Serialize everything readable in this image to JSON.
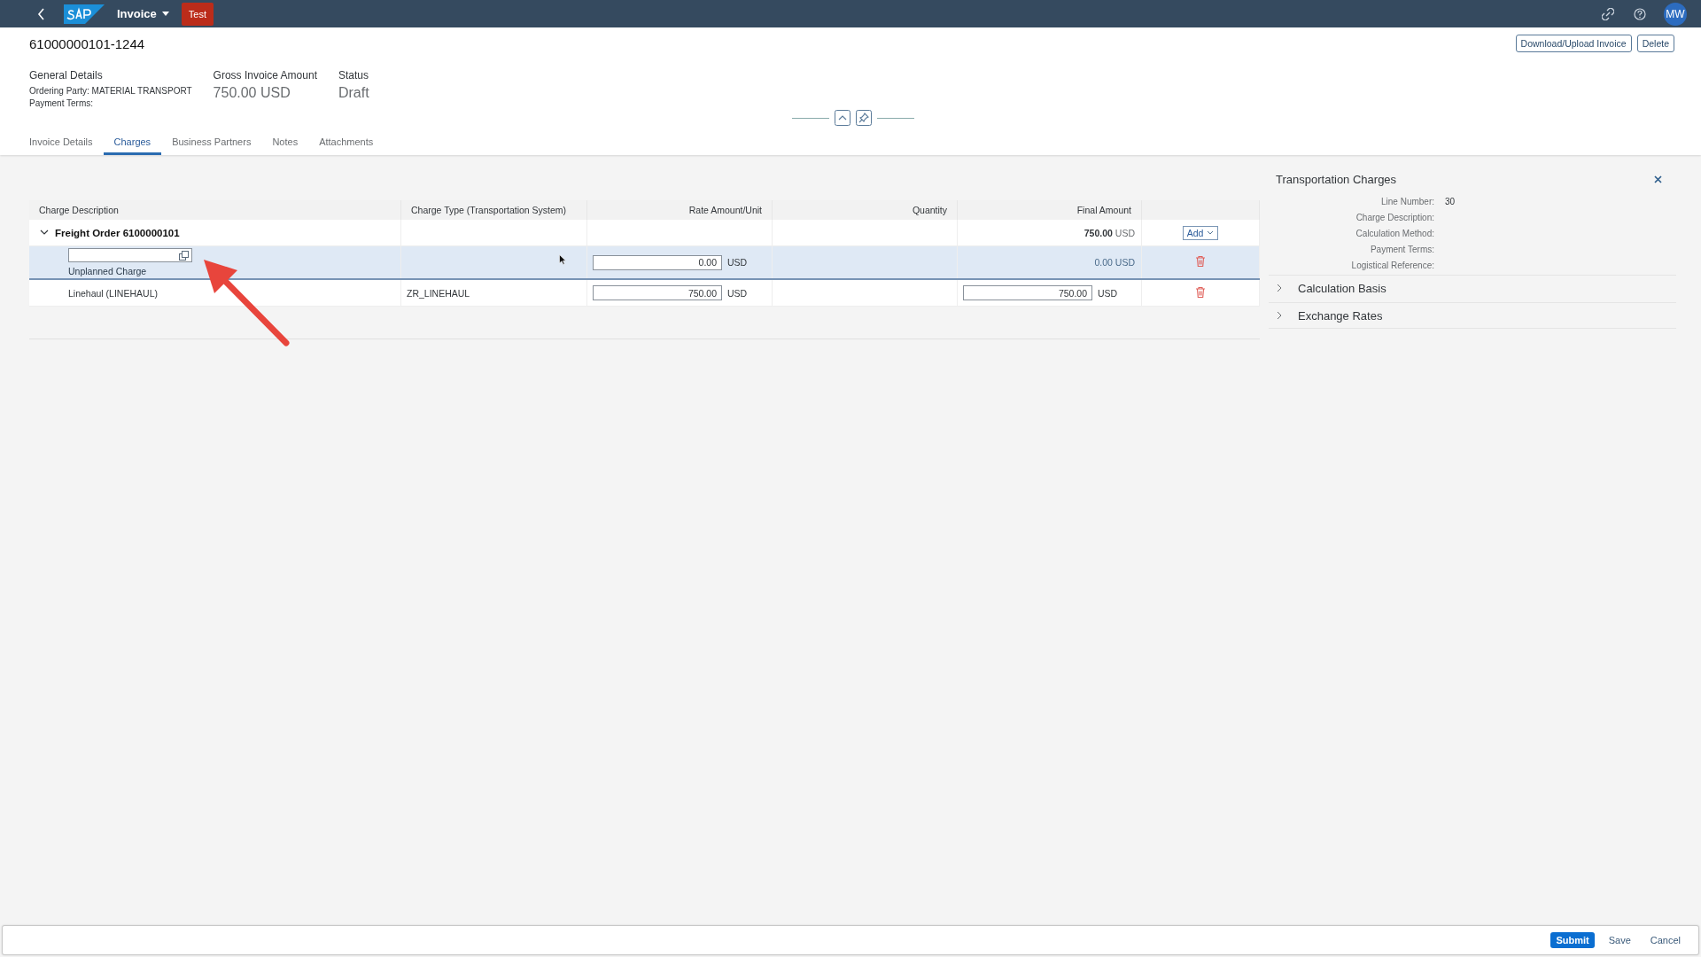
{
  "shell": {
    "title": "Invoice",
    "system_badge": "Test",
    "avatar": "MW"
  },
  "header": {
    "object_id": "61000000101-1244",
    "actions": [
      "Download/Upload Invoice",
      "Delete"
    ],
    "general": {
      "label": "General Details",
      "lines": [
        "Ordering Party: MATERIAL TRANSPORT",
        "Payment Terms:"
      ]
    },
    "kpis": [
      {
        "label": "Gross Invoice Amount",
        "value": "750.00 USD"
      },
      {
        "label": "Status",
        "value": "Draft"
      }
    ]
  },
  "tabs": [
    {
      "label": "Invoice Details",
      "selected": false
    },
    {
      "label": "Charges",
      "selected": true
    },
    {
      "label": "Business Partners",
      "selected": false
    },
    {
      "label": "Notes",
      "selected": false
    },
    {
      "label": "Attachments",
      "selected": false
    }
  ],
  "table": {
    "columns": [
      "Charge Description",
      "Charge Type (Transportation System)",
      "Rate Amount/Unit",
      "Quantity",
      "Final Amount"
    ],
    "rows": [
      {
        "kind": "group",
        "expanded": true,
        "description": "Freight Order 6100000101",
        "final_amount": "750.00",
        "final_currency": "USD",
        "add_button": "Add"
      },
      {
        "kind": "charge",
        "selected": true,
        "description_editable": true,
        "description": "Unplanned Charge",
        "rate": "0.00",
        "rate_currency": "USD",
        "final_editable": false,
        "final_amount": "0.00",
        "final_currency": "USD"
      },
      {
        "kind": "charge",
        "selected": false,
        "description_editable": false,
        "description": "Linehaul (LINEHAUL)",
        "charge_type": "ZR_LINEHAUL",
        "rate": "750.00",
        "rate_currency": "USD",
        "final_editable": true,
        "final_amount": "750.00",
        "final_currency": "USD"
      }
    ]
  },
  "panel": {
    "title": "Transportation Charges",
    "fields": [
      {
        "label": "Line Number:",
        "value": "30"
      },
      {
        "label": "Charge Description:"
      },
      {
        "label": "Calculation Method:"
      },
      {
        "label": "Payment Terms:"
      },
      {
        "label": "Logistical Reference:"
      }
    ],
    "sections": [
      {
        "title": "Calculation Basis",
        "expanded": false
      },
      {
        "title": "Exchange Rates",
        "expanded": false
      }
    ]
  },
  "footer": {
    "actions": [
      {
        "label": "Submit",
        "kind": "emphasized"
      },
      {
        "label": "Save",
        "kind": "transparent"
      },
      {
        "label": "Cancel",
        "kind": "transparent"
      }
    ]
  }
}
